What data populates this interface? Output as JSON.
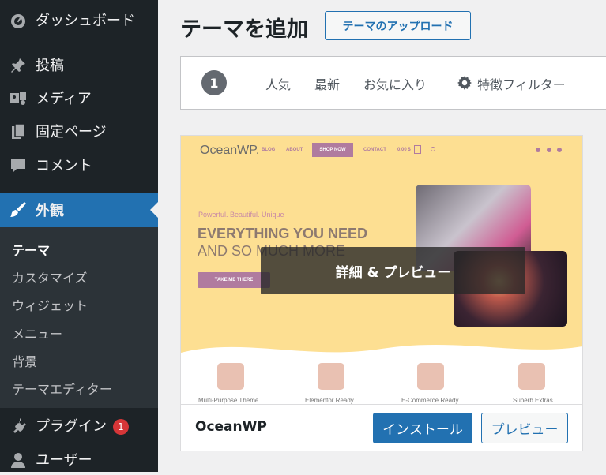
{
  "sidebar": {
    "dashboard": "ダッシュボード",
    "posts": "投稿",
    "media": "メディア",
    "pages": "固定ページ",
    "comments": "コメント",
    "appearance": "外観",
    "submenu": [
      "テーマ",
      "カスタマイズ",
      "ウィジェット",
      "メニュー",
      "背景",
      "テーマエディター"
    ],
    "plugins": "プラグイン",
    "plugins_badge": "1",
    "users": "ユーザー"
  },
  "header": {
    "title": "テーマを追加",
    "upload_button": "テーマのアップロード"
  },
  "filter_bar": {
    "count": "1",
    "tabs": [
      "人気",
      "最新",
      "お気に入り"
    ],
    "feature_filter": "特徴フィルター"
  },
  "theme_card": {
    "overlay_label": "詳細 & プレビュー",
    "name": "OceanWP",
    "install_button": "インストール",
    "preview_button": "プレビュー",
    "screenshot": {
      "logo": "OceanWP.",
      "nav": [
        "BLOG",
        "ABOUT",
        "SHOP NOW",
        "CONTACT",
        "0.00 $"
      ],
      "tagline": "Powerful. Beautiful. Unique",
      "headline1": "EVERYTHING YOU NEED",
      "headline2": "AND SO MUCH MORE",
      "cta": "TAKE ME THERE",
      "features": [
        "Multi-Purpose Theme",
        "Elementor Ready",
        "E-Commerce Ready",
        "Superb Extras"
      ]
    }
  },
  "colors": {
    "sidebar_bg": "#1d2327",
    "accent": "#2271b1",
    "submenu_bg": "#2c3338",
    "badge": "#d63638",
    "theme_bg": "#fddf92"
  }
}
